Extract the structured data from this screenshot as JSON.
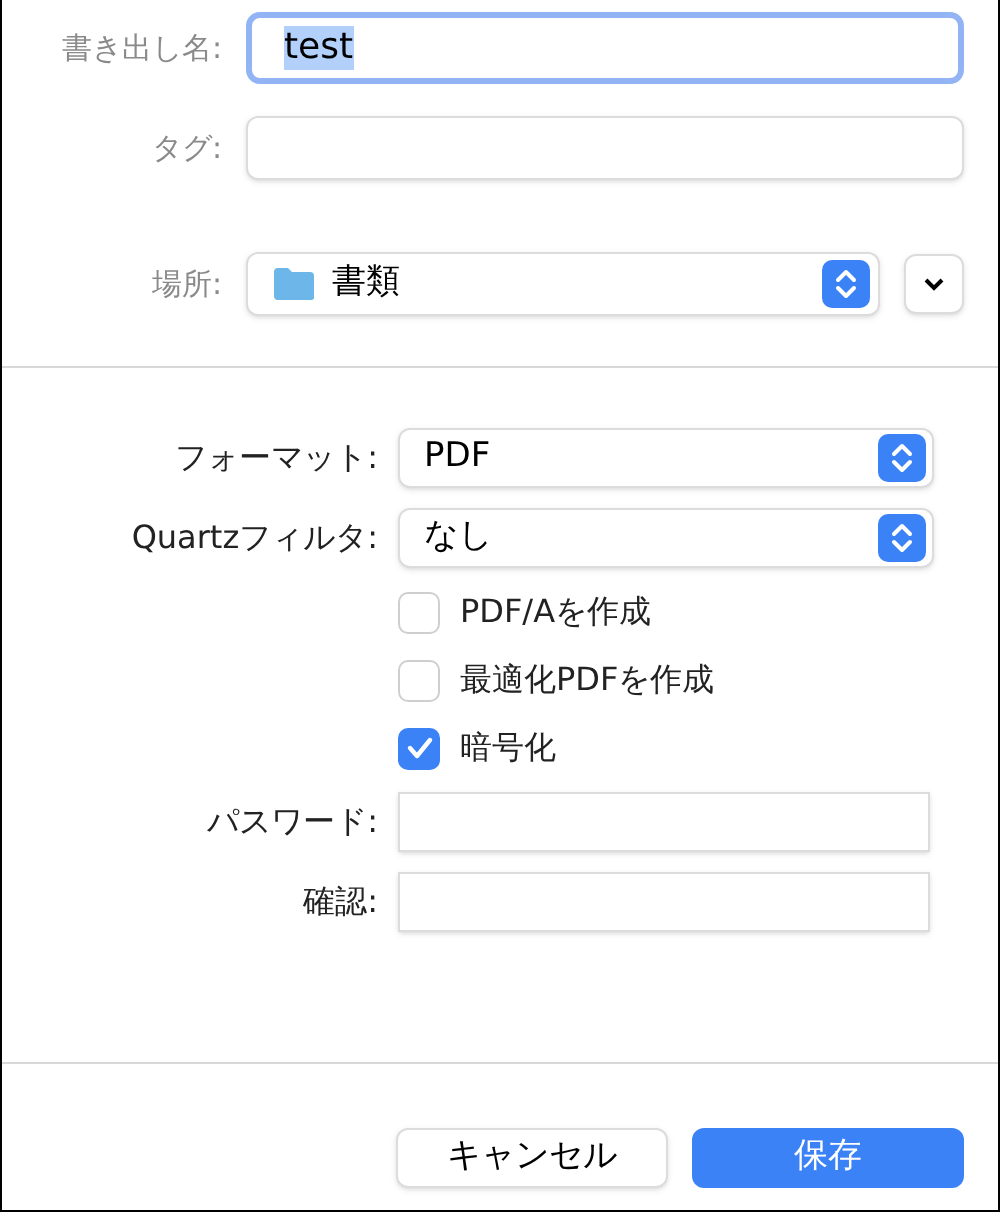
{
  "top_fields": [
    {
      "kind": "text",
      "label": "書き出し名:",
      "value": "test",
      "focused": true
    },
    {
      "kind": "text",
      "label": "タグ:",
      "focused": false
    },
    {
      "kind": "location",
      "label": "場所:",
      "value": "書類"
    }
  ],
  "options": [
    {
      "kind": "popup",
      "label": "フォーマット:",
      "value": "PDF"
    },
    {
      "kind": "popup",
      "label": "Quartzフィルタ:",
      "value": "なし"
    },
    {
      "kind": "checkbox",
      "label": "PDF/Aを作成",
      "checked": false
    },
    {
      "kind": "checkbox",
      "label": "最適化PDFを作成",
      "checked": false
    },
    {
      "kind": "checkbox",
      "label": "暗号化",
      "checked": true
    },
    {
      "kind": "field",
      "label": "パスワード:"
    },
    {
      "kind": "field",
      "label": "確認:"
    }
  ],
  "buttons": [
    {
      "label": "キャンセル",
      "primary": false
    },
    {
      "label": "保存",
      "primary": true
    }
  ]
}
